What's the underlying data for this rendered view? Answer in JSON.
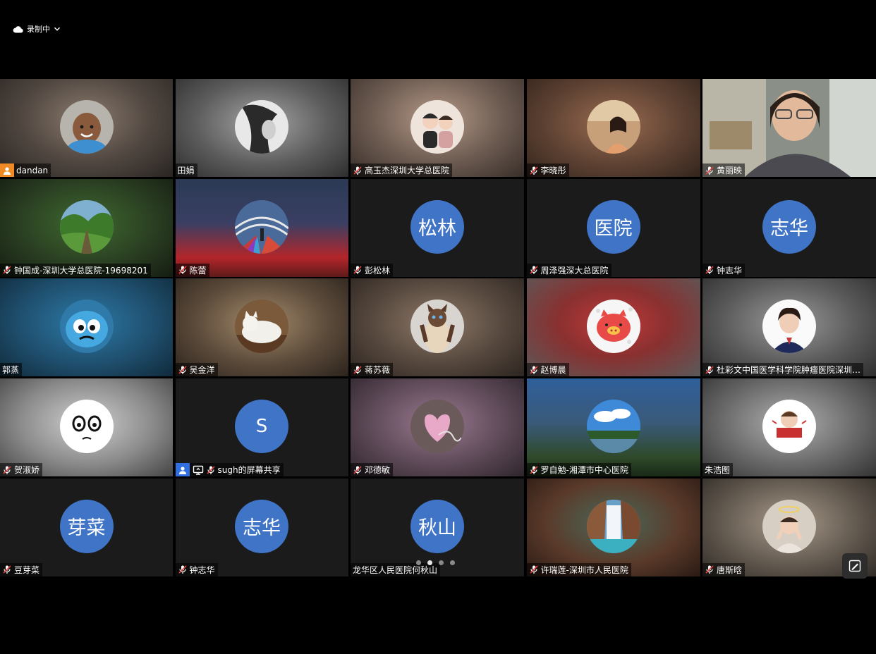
{
  "recording": {
    "label": "录制中",
    "icon": "cloud-icon"
  },
  "participants": [
    {
      "name": "dandan",
      "badge": "host",
      "avatar": "photo-baby"
    },
    {
      "name": "田娟",
      "badge": "none",
      "avatar": "photo-bw"
    },
    {
      "name": "高玉杰深圳大学总医院",
      "badge": "mic-muted",
      "avatar": "photo-cartoon-family"
    },
    {
      "name": "李晓彤",
      "badge": "mic-muted",
      "avatar": "photo-woman"
    },
    {
      "name": "黄丽映",
      "badge": "mic-muted",
      "avatar": "video"
    },
    {
      "name": "钟国成-深圳大学总医院-19698201",
      "badge": "mic-muted",
      "avatar": "photo-forest"
    },
    {
      "name": "陈蕾",
      "badge": "mic-muted",
      "avatar": "photo-flowers"
    },
    {
      "name": "彭松林",
      "badge": "mic-muted",
      "avatar_text": "松林"
    },
    {
      "name": "周泽强深大总医院",
      "badge": "mic-muted",
      "avatar_text": "医院"
    },
    {
      "name": "钟志华",
      "badge": "mic-muted",
      "avatar_text": "志华"
    },
    {
      "name": "郭蒸",
      "badge": "none",
      "avatar": "photo-cartoon-blue"
    },
    {
      "name": "吴金洋",
      "badge": "mic-muted",
      "avatar": "photo-cat-white"
    },
    {
      "name": "蒋苏薇",
      "badge": "mic-muted",
      "avatar": "photo-cat-siamese"
    },
    {
      "name": "赵博晨",
      "badge": "mic-muted",
      "avatar": "photo-pig"
    },
    {
      "name": "杜彩文中国医学科学院肿瘤医院深圳…",
      "badge": "mic-muted",
      "avatar": "photo-woman-portrait"
    },
    {
      "name": "贺淑娇",
      "badge": "mic-muted",
      "avatar": "photo-face-sketch"
    },
    {
      "name": "sugh的屏幕共享",
      "badge": "host-share",
      "avatar_text": "S"
    },
    {
      "name": "邓德敏",
      "badge": "mic-muted",
      "avatar": "photo-heart"
    },
    {
      "name": "罗自勉-湘潭市中心医院",
      "badge": "mic-muted",
      "avatar": "photo-sky"
    },
    {
      "name": "朱浩图",
      "badge": "none",
      "avatar": "photo-cartoon-boy"
    },
    {
      "name": "豆芽菜",
      "badge": "mic-muted",
      "avatar_text": "芽菜"
    },
    {
      "name": "钟志华",
      "badge": "mic-muted",
      "avatar_text": "志华"
    },
    {
      "name": "龙华区人民医院何秋山",
      "badge": "none",
      "avatar_text": "秋山"
    },
    {
      "name": "许瑞莲-深圳市人民医院",
      "badge": "mic-muted",
      "avatar": "photo-waterfall"
    },
    {
      "name": "唐斯晗",
      "badge": "mic-muted",
      "avatar": "photo-child"
    }
  ],
  "pagination": {
    "total": 4,
    "active": 1
  },
  "colors": {
    "avatar_bg": "#3f74c6",
    "host_badge": "#f08a24",
    "share_badge": "#2f6fe0"
  }
}
